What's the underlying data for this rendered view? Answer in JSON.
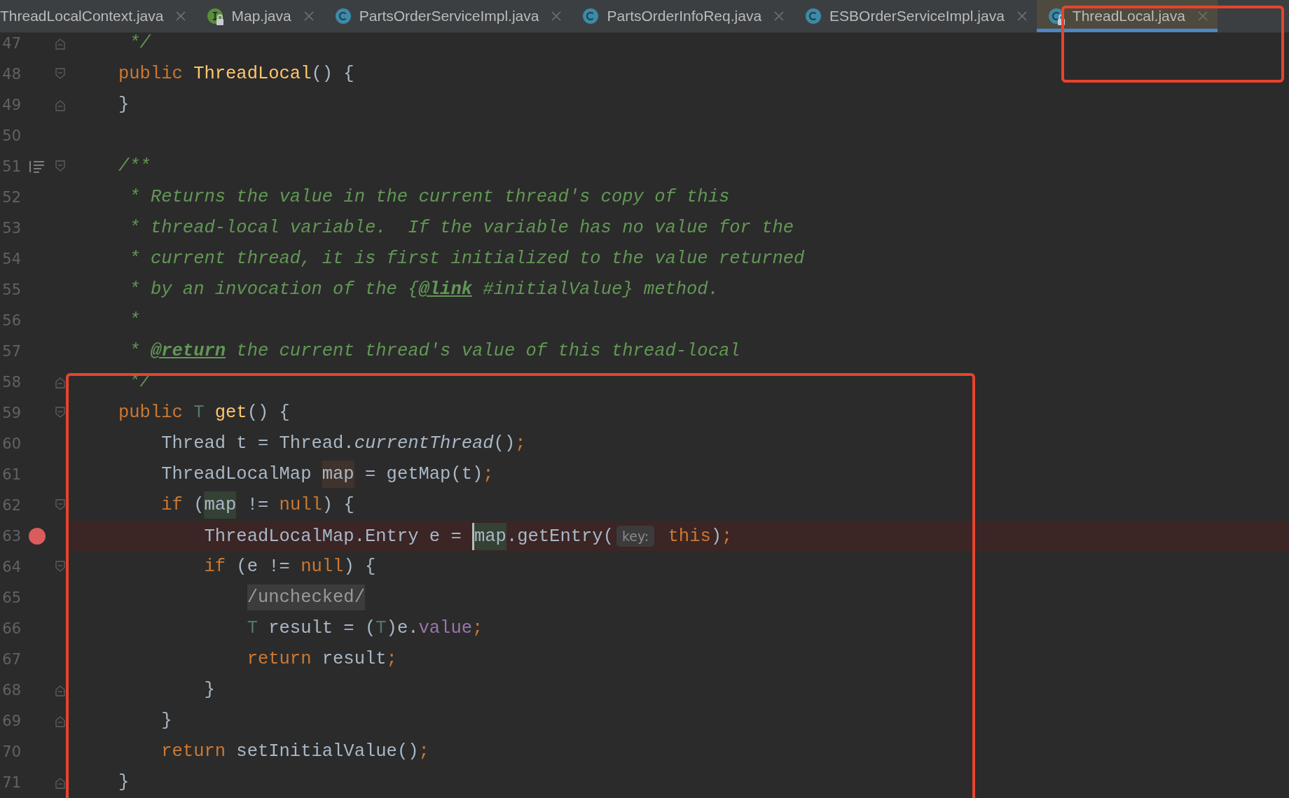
{
  "tabs": [
    {
      "label": "ThreadLocalContext.java",
      "kind": "plain",
      "selected": false
    },
    {
      "label": "Map.java",
      "kind": "interface",
      "locked": true,
      "selected": false
    },
    {
      "label": "PartsOrderServiceImpl.java",
      "kind": "class",
      "locked": false,
      "selected": false
    },
    {
      "label": "PartsOrderInfoReq.java",
      "kind": "class",
      "locked": false,
      "selected": false
    },
    {
      "label": "ESBOrderServiceImpl.java",
      "kind": "class",
      "locked": false,
      "selected": false
    },
    {
      "label": "ThreadLocal.java",
      "kind": "class",
      "locked": true,
      "selected": true
    }
  ],
  "editor": {
    "lines": [
      {
        "number": "47",
        "fold_start": false,
        "fold_end": true,
        "breakpoint": false,
        "current": false,
        "tokens": [
          {
            "kind": "doc",
            "text": " */"
          }
        ]
      },
      {
        "number": "48",
        "fold_start": true,
        "fold_end": false,
        "breakpoint": false,
        "current": false,
        "tokens": [
          {
            "kind": "keyword",
            "text": "public "
          },
          {
            "kind": "decl",
            "text": "ThreadLocal"
          },
          {
            "kind": "plain",
            "text": "() {"
          }
        ]
      },
      {
        "number": "49",
        "fold_start": false,
        "fold_end": true,
        "breakpoint": false,
        "current": false,
        "tokens": [
          {
            "kind": "plain",
            "text": "}"
          }
        ]
      },
      {
        "number": "50",
        "fold_start": false,
        "fold_end": false,
        "breakpoint": false,
        "current": false
      },
      {
        "number": "51",
        "fold_start": true,
        "fold_end": false,
        "doc_render": true,
        "breakpoint": false,
        "current": false,
        "tokens": [
          {
            "kind": "doc",
            "text": "/**"
          }
        ]
      },
      {
        "number": "52",
        "fold_start": false,
        "fold_end": false,
        "breakpoint": false,
        "current": false,
        "tokens": [
          {
            "kind": "doc",
            "text": " * Returns the value in the current thread's copy of this"
          }
        ]
      },
      {
        "number": "53",
        "fold_start": false,
        "fold_end": false,
        "breakpoint": false,
        "current": false,
        "tokens": [
          {
            "kind": "doc",
            "text": " * thread-local variable.  If the variable has no value for the"
          }
        ]
      },
      {
        "number": "54",
        "fold_start": false,
        "fold_end": false,
        "breakpoint": false,
        "current": false,
        "tokens": [
          {
            "kind": "doc",
            "text": " * current thread, it is first initialized to the value returned"
          }
        ]
      },
      {
        "number": "55",
        "fold_start": false,
        "fold_end": false,
        "breakpoint": false,
        "current": false,
        "tokens": [
          {
            "kind": "doc",
            "text": " * by an invocation of the {"
          },
          {
            "kind": "doctag",
            "text": "@link"
          },
          {
            "kind": "doc",
            "text": " #initialValue} method."
          }
        ]
      },
      {
        "number": "56",
        "fold_start": false,
        "fold_end": false,
        "breakpoint": false,
        "current": false,
        "tokens": [
          {
            "kind": "doc",
            "text": " *"
          }
        ]
      },
      {
        "number": "57",
        "fold_start": false,
        "fold_end": false,
        "breakpoint": false,
        "current": false,
        "tokens": [
          {
            "kind": "doc",
            "text": " * "
          },
          {
            "kind": "doctag",
            "text": "@return"
          },
          {
            "kind": "doc",
            "text": " the current thread's value of this thread-local"
          }
        ]
      },
      {
        "number": "58",
        "fold_start": false,
        "fold_end": true,
        "breakpoint": false,
        "current": false,
        "tokens": [
          {
            "kind": "doc",
            "text": " */"
          }
        ]
      },
      {
        "number": "59",
        "fold_start": true,
        "fold_end": false,
        "breakpoint": false,
        "current": false,
        "tokens": [
          {
            "kind": "keyword",
            "text": "public "
          },
          {
            "kind": "typeparam",
            "text": "T "
          },
          {
            "kind": "decl",
            "text": "get"
          },
          {
            "kind": "plain",
            "text": "() {"
          }
        ]
      },
      {
        "number": "60",
        "fold_start": false,
        "fold_end": false,
        "breakpoint": false,
        "current": false,
        "tokens": [
          {
            "kind": "plain",
            "text": "    Thread t = Thread."
          },
          {
            "kind": "static",
            "text": "currentThread"
          },
          {
            "kind": "plain",
            "text": "()"
          },
          {
            "kind": "punct",
            "text": ";"
          }
        ]
      },
      {
        "number": "61",
        "fold_start": false,
        "fold_end": false,
        "breakpoint": false,
        "current": false,
        "tokens": [
          {
            "kind": "plain",
            "text": "    ThreadLocalMap "
          },
          {
            "kind": "var_write",
            "text": "map"
          },
          {
            "kind": "plain",
            "text": " = getMap(t)"
          },
          {
            "kind": "punct",
            "text": ";"
          }
        ]
      },
      {
        "number": "62",
        "fold_start": true,
        "fold_end": false,
        "breakpoint": false,
        "current": false,
        "tokens": [
          {
            "kind": "keyword",
            "text": "    if "
          },
          {
            "kind": "plain",
            "text": "("
          },
          {
            "kind": "var_read",
            "text": "map"
          },
          {
            "kind": "plain",
            "text": " != "
          },
          {
            "kind": "keyword",
            "text": "null"
          },
          {
            "kind": "plain",
            "text": ") {"
          }
        ]
      },
      {
        "number": "63",
        "fold_start": false,
        "fold_end": false,
        "breakpoint": true,
        "current": true,
        "tokens": [
          {
            "kind": "plain",
            "text": "        ThreadLocalMap.Entry e = "
          },
          {
            "kind": "var_read",
            "text": "map",
            "caret": true
          },
          {
            "kind": "plain",
            "text": ".getEntry("
          },
          {
            "kind": "hint",
            "text": "key:"
          },
          {
            "kind": "keyword",
            "text": " this"
          },
          {
            "kind": "plain",
            "text": ")"
          },
          {
            "kind": "punct",
            "text": ";"
          }
        ]
      },
      {
        "number": "64",
        "fold_start": true,
        "fold_end": false,
        "breakpoint": false,
        "current": false,
        "tokens": [
          {
            "kind": "keyword",
            "text": "        if "
          },
          {
            "kind": "plain",
            "text": "(e != "
          },
          {
            "kind": "keyword",
            "text": "null"
          },
          {
            "kind": "plain",
            "text": ") {"
          }
        ]
      },
      {
        "number": "65",
        "fold_start": false,
        "fold_end": false,
        "breakpoint": false,
        "current": false,
        "tokens": [
          {
            "kind": "folded",
            "text": "            /unchecked/"
          }
        ]
      },
      {
        "number": "66",
        "fold_start": false,
        "fold_end": false,
        "breakpoint": false,
        "current": false,
        "tokens": [
          {
            "kind": "typeparam",
            "text": "            T "
          },
          {
            "kind": "plain",
            "text": "result = ("
          },
          {
            "kind": "typeparam",
            "text": "T"
          },
          {
            "kind": "plain",
            "text": ")e."
          },
          {
            "kind": "field",
            "text": "value"
          },
          {
            "kind": "punct",
            "text": ";"
          }
        ]
      },
      {
        "number": "67",
        "fold_start": false,
        "fold_end": false,
        "breakpoint": false,
        "current": false,
        "tokens": [
          {
            "kind": "keyword",
            "text": "            return "
          },
          {
            "kind": "plain",
            "text": "result"
          },
          {
            "kind": "punct",
            "text": ";"
          }
        ]
      },
      {
        "number": "68",
        "fold_start": false,
        "fold_end": true,
        "breakpoint": false,
        "current": false,
        "tokens": [
          {
            "kind": "plain",
            "text": "        }"
          }
        ]
      },
      {
        "number": "69",
        "fold_start": false,
        "fold_end": true,
        "breakpoint": false,
        "current": false,
        "tokens": [
          {
            "kind": "plain",
            "text": "    }"
          }
        ]
      },
      {
        "number": "70",
        "fold_start": false,
        "fold_end": false,
        "breakpoint": false,
        "current": false,
        "tokens": [
          {
            "kind": "keyword",
            "text": "    return "
          },
          {
            "kind": "plain",
            "text": "setInitialValue()"
          },
          {
            "kind": "punct",
            "text": ";"
          }
        ]
      },
      {
        "number": "71",
        "fold_start": false,
        "fold_end": true,
        "breakpoint": false,
        "current": false,
        "tokens": [
          {
            "kind": "plain",
            "text": "}"
          }
        ]
      }
    ]
  }
}
